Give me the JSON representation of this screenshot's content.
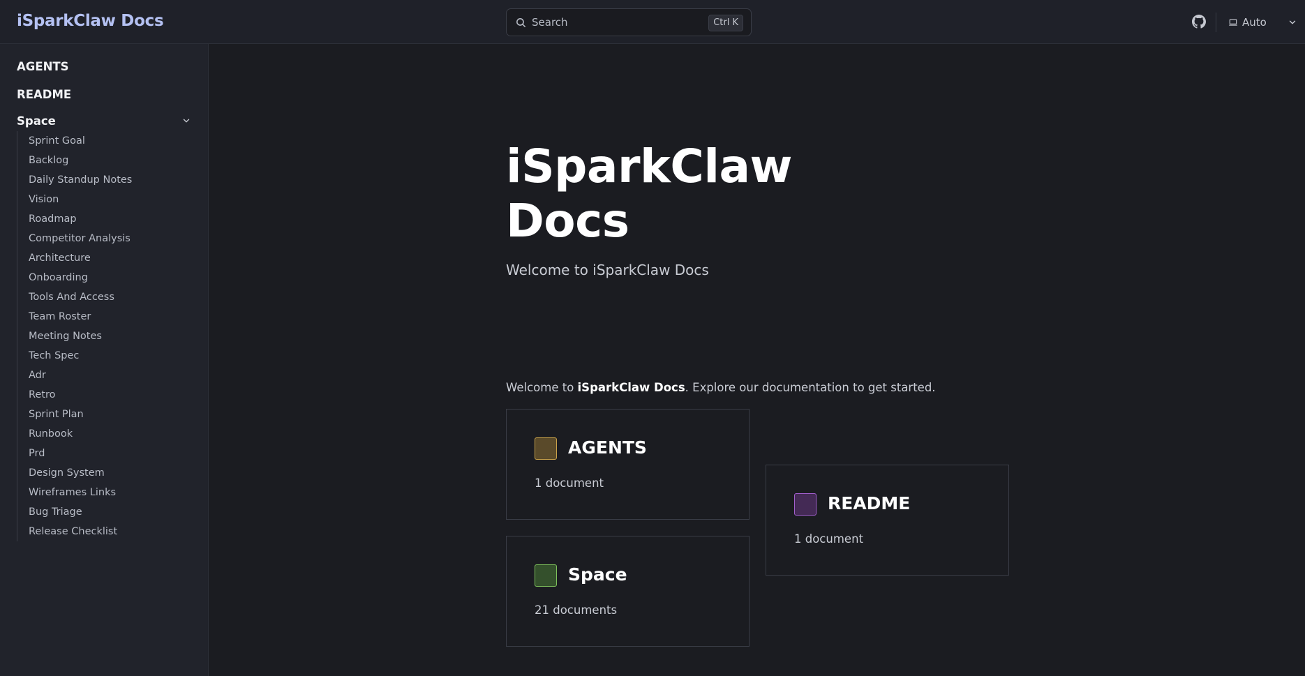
{
  "header": {
    "brand": "iSparkClaw Docs",
    "search_placeholder": "Search",
    "search_shortcut": "Ctrl K",
    "theme_label": "Auto"
  },
  "sidebar": {
    "top_items": [
      {
        "label": "AGENTS"
      },
      {
        "label": "README"
      }
    ],
    "section": {
      "label": "Space",
      "expanded": true,
      "items": [
        {
          "label": "Sprint Goal"
        },
        {
          "label": "Backlog"
        },
        {
          "label": "Daily Standup Notes"
        },
        {
          "label": "Vision"
        },
        {
          "label": "Roadmap"
        },
        {
          "label": "Competitor Analysis"
        },
        {
          "label": "Architecture"
        },
        {
          "label": "Onboarding"
        },
        {
          "label": "Tools And Access"
        },
        {
          "label": "Team Roster"
        },
        {
          "label": "Meeting Notes"
        },
        {
          "label": "Tech Spec"
        },
        {
          "label": "Adr"
        },
        {
          "label": "Retro"
        },
        {
          "label": "Sprint Plan"
        },
        {
          "label": "Runbook"
        },
        {
          "label": "Prd"
        },
        {
          "label": "Design System"
        },
        {
          "label": "Wireframes Links"
        },
        {
          "label": "Bug Triage"
        },
        {
          "label": "Release Checklist"
        }
      ]
    }
  },
  "hero": {
    "title_line1": "iSparkClaw",
    "title_line2": "Docs",
    "subtitle": "Welcome to iSparkClaw Docs"
  },
  "intro": {
    "prefix": "Welcome to ",
    "strong": "iSparkClaw Docs",
    "suffix": ". Explore our documentation to get started."
  },
  "cards": [
    {
      "title": "AGENTS",
      "count": "1 document",
      "fill": "#5a4a2a",
      "border": "#c9a24a"
    },
    {
      "title": "README",
      "count": "1 document",
      "fill": "#442a55",
      "border": "#a45fcf"
    },
    {
      "title": "Space",
      "count": "21 documents",
      "fill": "#34502c",
      "border": "#7ec15c"
    }
  ],
  "icons": {
    "search": "search-icon",
    "github": "github-icon",
    "theme": "laptop-icon",
    "chevron": "chevron-down-icon"
  }
}
